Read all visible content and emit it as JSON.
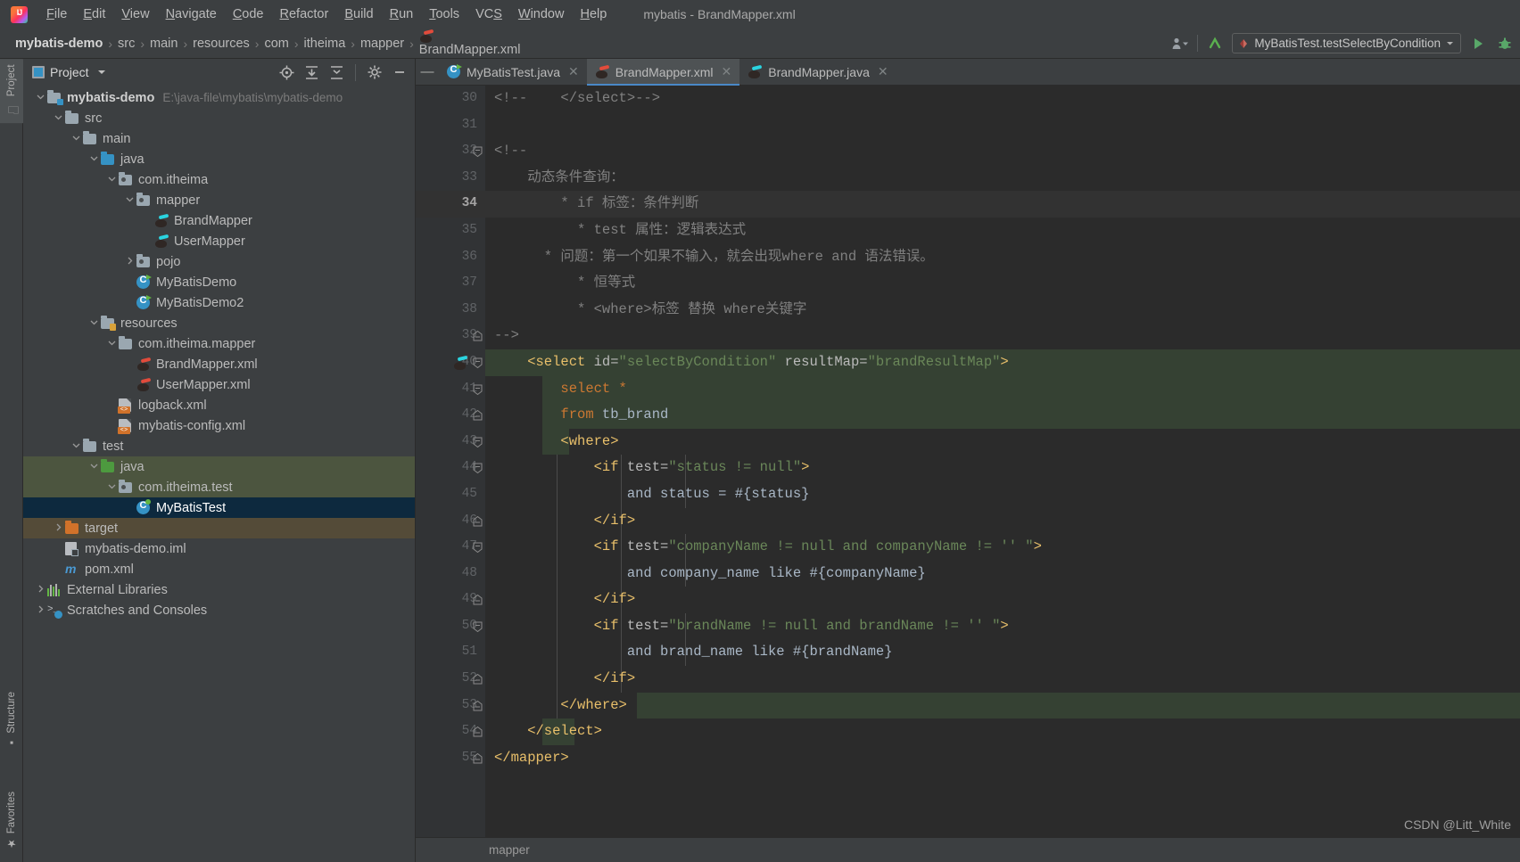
{
  "app": {
    "window_title": "mybatis - BrandMapper.xml",
    "logo": "intellij-idea-logo"
  },
  "menubar": {
    "items": [
      {
        "label": "File",
        "mnemonic": "F"
      },
      {
        "label": "Edit",
        "mnemonic": "E"
      },
      {
        "label": "View",
        "mnemonic": "V"
      },
      {
        "label": "Navigate",
        "mnemonic": "N"
      },
      {
        "label": "Code",
        "mnemonic": "C"
      },
      {
        "label": "Refactor",
        "mnemonic": "R"
      },
      {
        "label": "Build",
        "mnemonic": "B"
      },
      {
        "label": "Run",
        "mnemonic": "R"
      },
      {
        "label": "Tools",
        "mnemonic": "T"
      },
      {
        "label": "VCS",
        "mnemonic": "S"
      },
      {
        "label": "Window",
        "mnemonic": "W"
      },
      {
        "label": "Help",
        "mnemonic": "H"
      }
    ]
  },
  "navbar": {
    "breadcrumbs": [
      "mybatis-demo",
      "src",
      "main",
      "resources",
      "com",
      "itheima",
      "mapper",
      "BrandMapper.xml"
    ],
    "separator": "›",
    "run_config": "MyBatisTest.testSelectByCondition",
    "icons": [
      "user-chevron-icon",
      "update-project-icon",
      "run-icon",
      "debug-icon",
      "dropdown-chevron-icon"
    ]
  },
  "toolstrip": {
    "tabs": [
      {
        "label": "Project",
        "icon": "folder-icon",
        "active": true
      },
      {
        "label": "Structure",
        "icon": "structure-icon",
        "active": false
      },
      {
        "label": "Favorites",
        "icon": "star-icon",
        "active": false
      }
    ]
  },
  "project_panel": {
    "title": "Project",
    "header_icons": [
      "locate-icon",
      "expand-all-icon",
      "collapse-all-icon",
      "gear-icon",
      "hide-icon"
    ],
    "tree": [
      {
        "depth": 0,
        "arrow": "down",
        "icon": "module-folder-icon",
        "label": "mybatis-demo",
        "bold": true,
        "sub": "E:\\java-file\\mybatis\\mybatis-demo",
        "state": "normal"
      },
      {
        "depth": 1,
        "arrow": "down",
        "icon": "folder-icon",
        "label": "src",
        "state": "normal"
      },
      {
        "depth": 2,
        "arrow": "down",
        "icon": "folder-icon",
        "label": "main",
        "state": "normal"
      },
      {
        "depth": 3,
        "arrow": "down",
        "icon": "source-folder-icon",
        "label": "java",
        "state": "normal"
      },
      {
        "depth": 4,
        "arrow": "down",
        "icon": "package-icon",
        "label": "com.itheima",
        "state": "normal"
      },
      {
        "depth": 5,
        "arrow": "down",
        "icon": "package-icon",
        "label": "mapper",
        "state": "normal"
      },
      {
        "depth": 6,
        "arrow": "none",
        "icon": "mybatis-mapper-icon",
        "label": "BrandMapper",
        "state": "normal"
      },
      {
        "depth": 6,
        "arrow": "none",
        "icon": "mybatis-mapper-icon",
        "label": "UserMapper",
        "state": "normal"
      },
      {
        "depth": 5,
        "arrow": "right",
        "icon": "package-icon",
        "label": "pojo",
        "state": "normal"
      },
      {
        "depth": 5,
        "arrow": "none",
        "icon": "java-class-icon",
        "label": "MyBatisDemo",
        "state": "normal"
      },
      {
        "depth": 5,
        "arrow": "none",
        "icon": "java-class-icon",
        "label": "MyBatisDemo2",
        "state": "normal"
      },
      {
        "depth": 3,
        "arrow": "down",
        "icon": "resources-folder-icon",
        "label": "resources",
        "state": "normal"
      },
      {
        "depth": 4,
        "arrow": "down",
        "icon": "folder-icon",
        "label": "com.itheima.mapper",
        "state": "normal"
      },
      {
        "depth": 5,
        "arrow": "none",
        "icon": "mybatis-xml-icon",
        "label": "BrandMapper.xml",
        "state": "normal"
      },
      {
        "depth": 5,
        "arrow": "none",
        "icon": "mybatis-xml-icon",
        "label": "UserMapper.xml",
        "state": "normal"
      },
      {
        "depth": 4,
        "arrow": "none",
        "icon": "xml-file-icon",
        "label": "logback.xml",
        "state": "normal"
      },
      {
        "depth": 4,
        "arrow": "none",
        "icon": "xml-file-icon",
        "label": "mybatis-config.xml",
        "state": "normal"
      },
      {
        "depth": 2,
        "arrow": "down",
        "icon": "folder-icon",
        "label": "test",
        "state": "normal"
      },
      {
        "depth": 3,
        "arrow": "down",
        "icon": "test-source-folder-icon",
        "label": "java",
        "state": "green"
      },
      {
        "depth": 4,
        "arrow": "down",
        "icon": "package-icon",
        "label": "com.itheima.test",
        "state": "green"
      },
      {
        "depth": 5,
        "arrow": "none",
        "icon": "java-test-class-icon",
        "label": "MyBatisTest",
        "state": "selected"
      },
      {
        "depth": 1,
        "arrow": "right",
        "icon": "excluded-folder-icon",
        "label": "target",
        "state": "brown"
      },
      {
        "depth": 1,
        "arrow": "none",
        "icon": "iml-file-icon",
        "label": "mybatis-demo.iml",
        "state": "normal"
      },
      {
        "depth": 1,
        "arrow": "none",
        "icon": "maven-icon",
        "label": "pom.xml",
        "state": "normal"
      },
      {
        "depth": 0,
        "arrow": "right",
        "icon": "external-libraries-icon",
        "label": "External Libraries",
        "state": "normal"
      },
      {
        "depth": 0,
        "arrow": "right",
        "icon": "scratches-icon",
        "label": "Scratches and Consoles",
        "state": "normal"
      }
    ]
  },
  "editor": {
    "tabs": [
      {
        "label": "MyBatisTest.java",
        "icon": "java-class-icon",
        "active": false,
        "closable": true
      },
      {
        "label": "BrandMapper.xml",
        "icon": "mybatis-xml-icon",
        "active": true,
        "closable": true
      },
      {
        "label": "BrandMapper.java",
        "icon": "mybatis-mapper-icon",
        "active": false,
        "closable": true
      }
    ],
    "current_line": 34,
    "first_line": 30,
    "last_line": 55,
    "breadcrumb": "mapper",
    "lines": [
      {
        "n": 30,
        "fold": "none",
        "tokens": [
          {
            "t": "cmt",
            "v": "<!--    </select>-->"
          }
        ]
      },
      {
        "n": 31,
        "fold": "none",
        "tokens": []
      },
      {
        "n": 32,
        "fold": "start",
        "tokens": [
          {
            "t": "cmt",
            "v": "<!--"
          }
        ]
      },
      {
        "n": 33,
        "fold": "none",
        "tokens": [
          {
            "t": "cmt",
            "v": "    动态条件查询："
          }
        ]
      },
      {
        "n": 34,
        "fold": "none",
        "tokens": [
          {
            "t": "cmt",
            "v": "        * if 标签：条件判断"
          }
        ]
      },
      {
        "n": 35,
        "fold": "none",
        "tokens": [
          {
            "t": "cmt",
            "v": "          * test 属性：逻辑表达式"
          }
        ]
      },
      {
        "n": 36,
        "fold": "none",
        "tokens": [
          {
            "t": "cmt",
            "v": "      * 问题：第一个如果不输入，就会出现where and 语法错误。"
          }
        ]
      },
      {
        "n": 37,
        "fold": "none",
        "tokens": [
          {
            "t": "cmt",
            "v": "          * 恒等式"
          }
        ]
      },
      {
        "n": 38,
        "fold": "none",
        "tokens": [
          {
            "t": "cmt",
            "v": "          * <where>标签 替换 where关键字"
          }
        ]
      },
      {
        "n": 39,
        "fold": "end",
        "tokens": [
          {
            "t": "cmt",
            "v": "-->"
          }
        ]
      },
      {
        "n": 40,
        "fold": "start",
        "gutter_icon": "mybatis-statement-icon",
        "tokens": [
          {
            "t": "tag",
            "v": "    <select "
          },
          {
            "t": "attr",
            "v": "id="
          },
          {
            "t": "str",
            "v": "\"selectByCondition\""
          },
          {
            "t": "attr",
            "v": " resultMap="
          },
          {
            "t": "str",
            "v": "\"brandResultMap\""
          },
          {
            "t": "tag",
            "v": ">"
          }
        ]
      },
      {
        "n": 41,
        "fold": "start",
        "tokens": [
          {
            "t": "kw",
            "v": "        select "
          },
          {
            "t": "kw",
            "v": "*"
          }
        ]
      },
      {
        "n": 42,
        "fold": "end",
        "tokens": [
          {
            "t": "kw",
            "v": "        from "
          },
          {
            "t": "txt",
            "v": "tb_brand"
          }
        ]
      },
      {
        "n": 43,
        "fold": "start",
        "tokens": [
          {
            "t": "tag",
            "v": "        <where>"
          }
        ]
      },
      {
        "n": 44,
        "fold": "start",
        "tokens": [
          {
            "t": "tag",
            "v": "            <if "
          },
          {
            "t": "attr",
            "v": "test="
          },
          {
            "t": "str",
            "v": "\"status != null\""
          },
          {
            "t": "tag",
            "v": ">"
          }
        ]
      },
      {
        "n": 45,
        "fold": "none",
        "tokens": [
          {
            "t": "txt",
            "v": "                and status = #{status}"
          }
        ]
      },
      {
        "n": 46,
        "fold": "end",
        "tokens": [
          {
            "t": "tag",
            "v": "            </if>"
          }
        ]
      },
      {
        "n": 47,
        "fold": "start",
        "tokens": [
          {
            "t": "tag",
            "v": "            <if "
          },
          {
            "t": "attr",
            "v": "test="
          },
          {
            "t": "str",
            "v": "\"companyName != null and companyName != '' \""
          },
          {
            "t": "tag",
            "v": ">"
          }
        ]
      },
      {
        "n": 48,
        "fold": "none",
        "tokens": [
          {
            "t": "txt",
            "v": "                and company_name like #{companyName}"
          }
        ]
      },
      {
        "n": 49,
        "fold": "end",
        "tokens": [
          {
            "t": "tag",
            "v": "            </if>"
          }
        ]
      },
      {
        "n": 50,
        "fold": "start",
        "tokens": [
          {
            "t": "tag",
            "v": "            <if "
          },
          {
            "t": "attr",
            "v": "test="
          },
          {
            "t": "str",
            "v": "\"brandName != null and brandName != '' \""
          },
          {
            "t": "tag",
            "v": ">"
          }
        ]
      },
      {
        "n": 51,
        "fold": "none",
        "tokens": [
          {
            "t": "txt",
            "v": "                and brand_name like #{brandName}"
          }
        ]
      },
      {
        "n": 52,
        "fold": "end",
        "tokens": [
          {
            "t": "tag",
            "v": "            </if>"
          }
        ]
      },
      {
        "n": 53,
        "fold": "end",
        "tokens": [
          {
            "t": "tag",
            "v": "        </where>"
          }
        ]
      },
      {
        "n": 54,
        "fold": "end",
        "tokens": [
          {
            "t": "tag",
            "v": "    </select>"
          }
        ]
      },
      {
        "n": 55,
        "fold": "end",
        "tokens": [
          {
            "t": "tag",
            "v": "</mapper>"
          }
        ]
      }
    ]
  },
  "watermark": "CSDN @Litt_White",
  "colors": {
    "background": "#3c3f41",
    "editor_background": "#2b2b2b",
    "gutter_background": "#313335",
    "accent_blue": "#4a88c7",
    "selection_blue": "#0d293e",
    "highlight_green": "#354133",
    "tree_green": "#4c553f",
    "tree_brown": "#544b38",
    "tag_color": "#e8bf6a",
    "string_color": "#6a8759",
    "keyword_color": "#cc7832",
    "comment_color": "#808080",
    "text_color": "#a9b7c6"
  }
}
